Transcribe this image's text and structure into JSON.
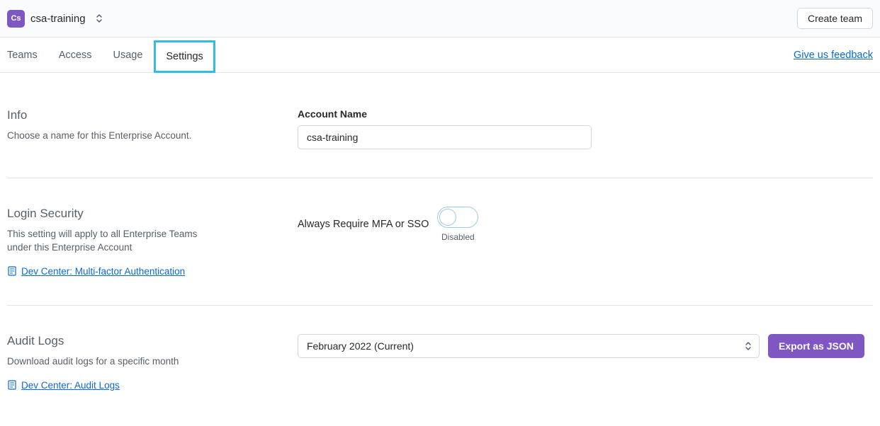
{
  "header": {
    "org_badge": "Cs",
    "org_name": "csa-training",
    "create_team_label": "Create team"
  },
  "nav": {
    "tabs": [
      "Teams",
      "Access",
      "Usage",
      "Settings"
    ],
    "feedback": "Give us feedback"
  },
  "info": {
    "title": "Info",
    "desc": "Choose a name for this Enterprise Account.",
    "field_label": "Account Name",
    "field_value": "csa-training"
  },
  "security": {
    "title": "Login Security",
    "desc": "This setting will apply to all Enterprise Teams under this Enterprise Account",
    "doc_link": "Dev Center: Multi-factor Authentication",
    "toggle_label": "Always Require MFA or SSO",
    "toggle_state": "Disabled"
  },
  "audit": {
    "title": "Audit Logs",
    "desc": "Download audit logs for a specific month",
    "doc_link": "Dev Center: Audit Logs",
    "month_selected": "February 2022 (Current)",
    "export_label": "Export as JSON"
  }
}
